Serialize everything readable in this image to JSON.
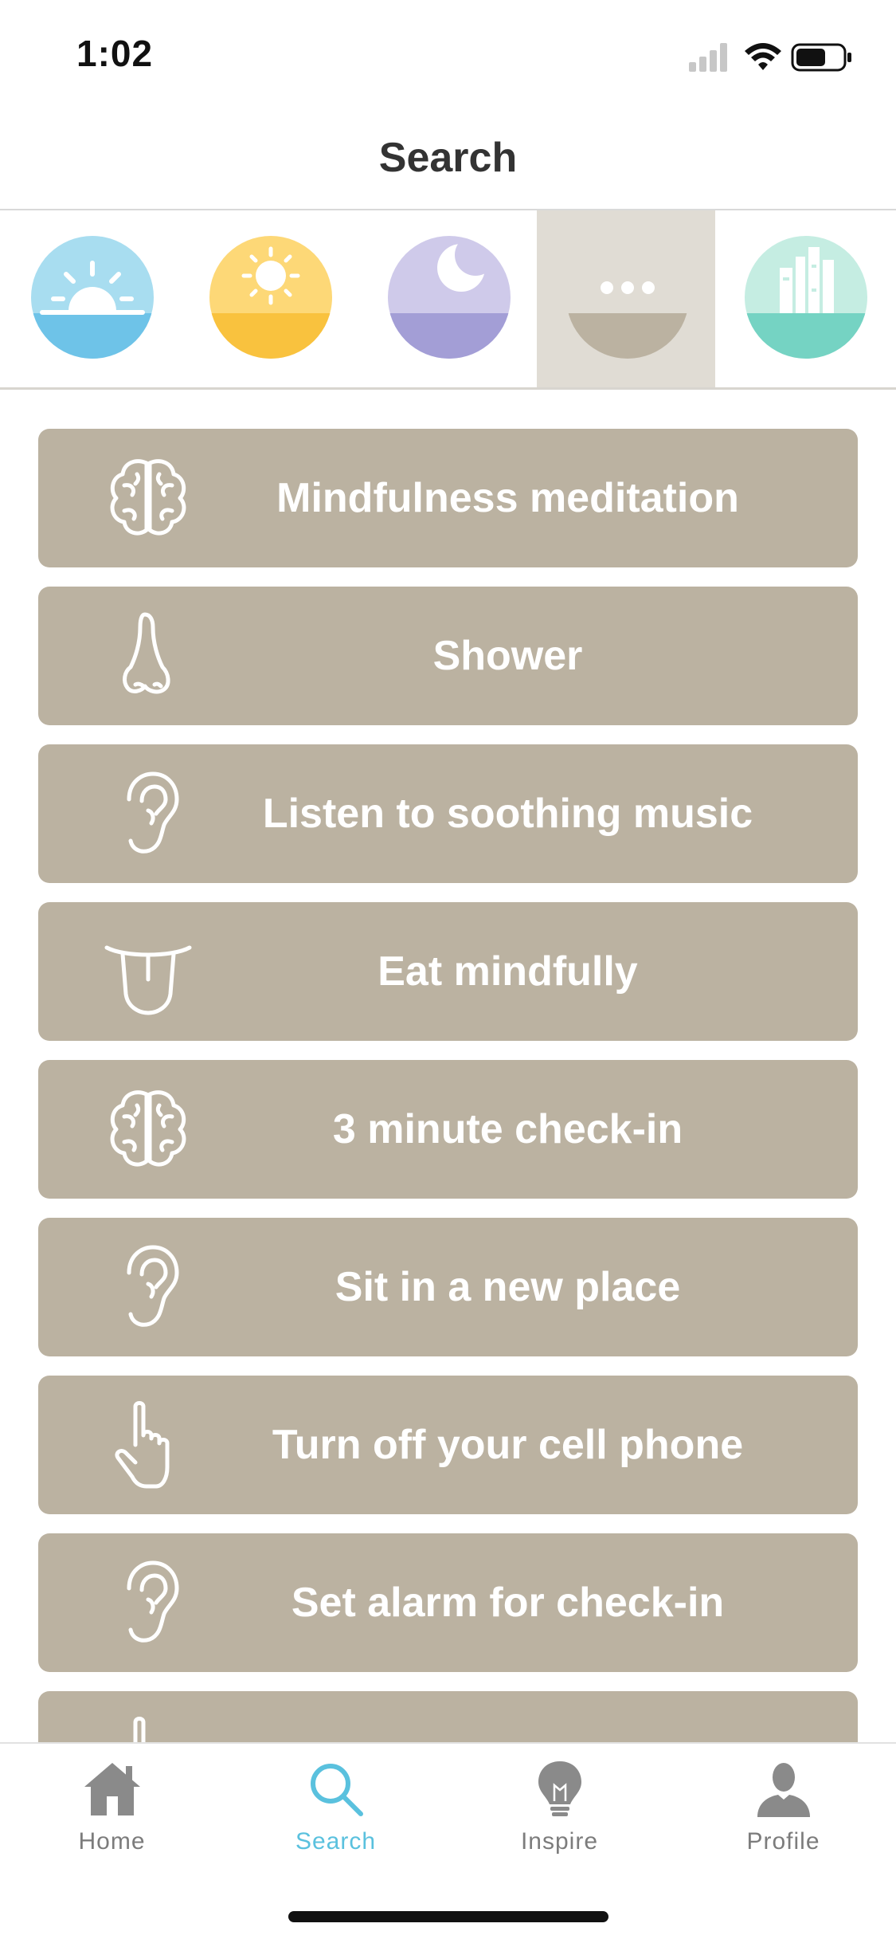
{
  "status_bar": {
    "time": "1:02"
  },
  "header": {
    "title": "Search"
  },
  "categories": [
    {
      "icon": "sunrise-icon",
      "colors": [
        "#a8ddf0",
        "#6ec3e8"
      ],
      "active": false
    },
    {
      "icon": "sun-icon",
      "colors": [
        "#fdd877",
        "#f9c23e"
      ],
      "active": false
    },
    {
      "icon": "moon-icon",
      "colors": [
        "#cfcaea",
        "#a39ed6"
      ],
      "active": false
    },
    {
      "icon": "more-icon",
      "colors": [
        "#e0dcd4",
        "#bbb2a1"
      ],
      "active": true
    },
    {
      "icon": "books-icon",
      "colors": [
        "#c5ede2",
        "#75d3c3"
      ],
      "active": false
    }
  ],
  "activities": [
    {
      "icon": "brain-icon",
      "label": "Mindfulness meditation"
    },
    {
      "icon": "nose-icon",
      "label": "Shower"
    },
    {
      "icon": "ear-icon",
      "label": "Listen to soothing music"
    },
    {
      "icon": "tongue-icon",
      "label": "Eat mindfully"
    },
    {
      "icon": "brain-icon",
      "label": "3 minute check-in"
    },
    {
      "icon": "ear-icon",
      "label": "Sit in a new place"
    },
    {
      "icon": "hand-pointer-icon",
      "label": "Turn off your cell phone"
    },
    {
      "icon": "ear-icon",
      "label": "Set alarm for check-in"
    },
    {
      "icon": "hand-pointer-icon",
      "label": ""
    }
  ],
  "tab_bar": {
    "accent_color": "#5ac1de",
    "tabs": [
      {
        "icon": "home-icon",
        "label": "Home"
      },
      {
        "icon": "search-icon",
        "label": "Search",
        "active": true
      },
      {
        "icon": "lightbulb-icon",
        "label": "Inspire"
      },
      {
        "icon": "profile-icon",
        "label": "Profile"
      }
    ]
  }
}
